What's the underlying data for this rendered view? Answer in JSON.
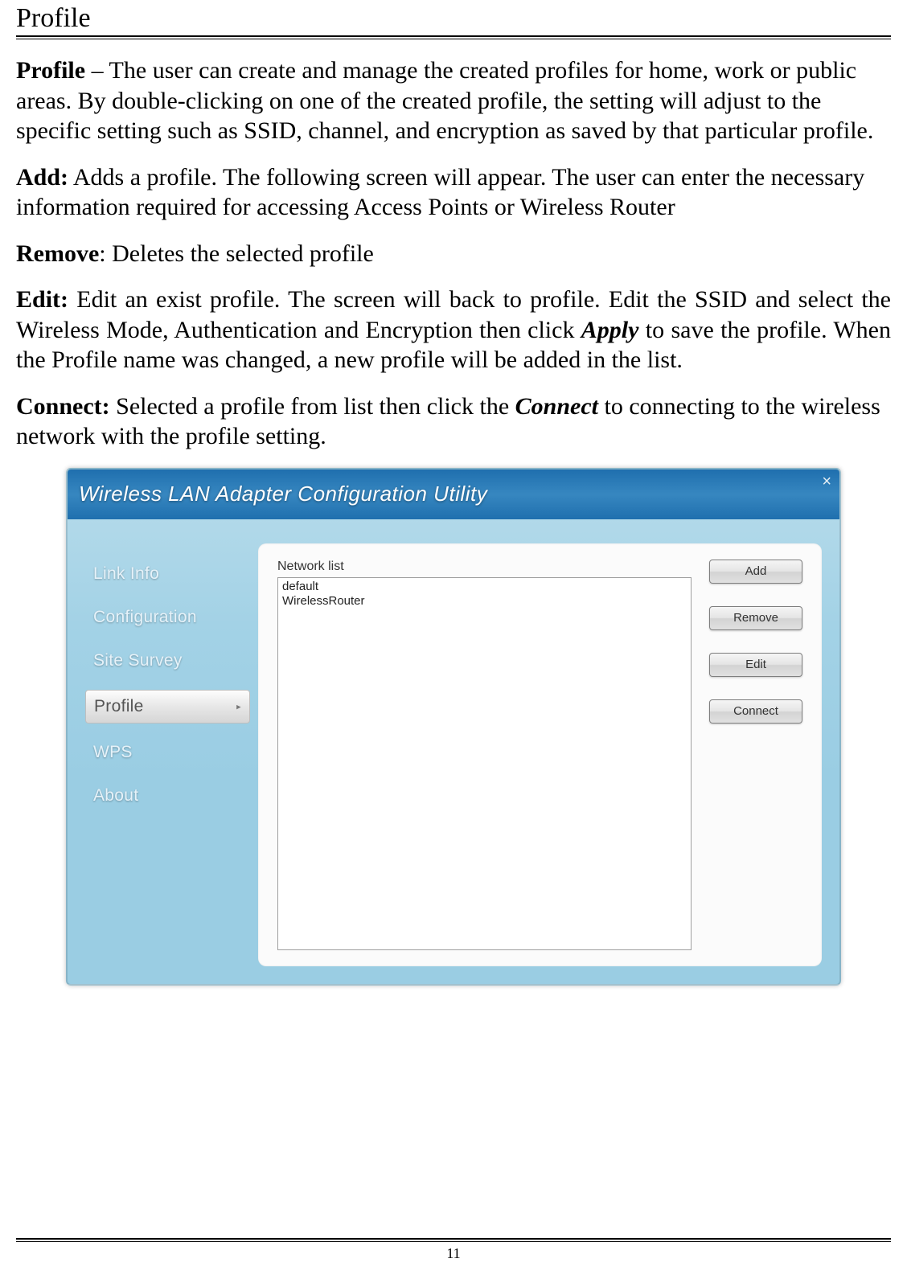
{
  "page_title": "Profile",
  "page_number": "11",
  "paragraphs": {
    "p1_label": "Profile",
    "p1_sep": " – ",
    "p1_text": "The user can create and manage the created profiles for home, work or public areas. By double-clicking on one of the created profile, the setting will adjust to the specific setting such as SSID, channel, and encryption as saved by that particular profile.",
    "p2_label": "Add:",
    "p2_text": " Adds a profile. The following screen will appear. The user can enter the necessary information required for accessing Access Points or Wireless Router",
    "p3_label": "Remove",
    "p3_text": ": Deletes the selected profile",
    "p4_label": "Edit:",
    "p4_text_a": " Edit an exist profile. The screen will back to profile. Edit the SSID and select the Wireless Mode, Authentication and Encryption then click ",
    "p4_emph": "Apply",
    "p4_text_b": " to save the profile. When the Profile name was changed, a new profile will be added in the list.",
    "p5_label": "Connect:",
    "p5_text_a": " Selected a profile from list then click the ",
    "p5_emph": "Connect",
    "p5_text_b": " to connecting to the wireless network with the profile setting."
  },
  "app": {
    "title": "Wireless LAN Adapter Configuration Utility",
    "close_glyph": "×",
    "sidebar": [
      {
        "label": "Link Info",
        "active": false
      },
      {
        "label": "Configuration",
        "active": false
      },
      {
        "label": "Site Survey",
        "active": false
      },
      {
        "label": "Profile",
        "active": true
      },
      {
        "label": "WPS",
        "active": false
      },
      {
        "label": "About",
        "active": false
      }
    ],
    "arrow_glyph": "▸",
    "list_label": "Network list",
    "network_items": [
      "default",
      "WirelessRouter"
    ],
    "buttons": {
      "add": "Add",
      "remove": "Remove",
      "edit": "Edit",
      "connect": "Connect"
    }
  }
}
